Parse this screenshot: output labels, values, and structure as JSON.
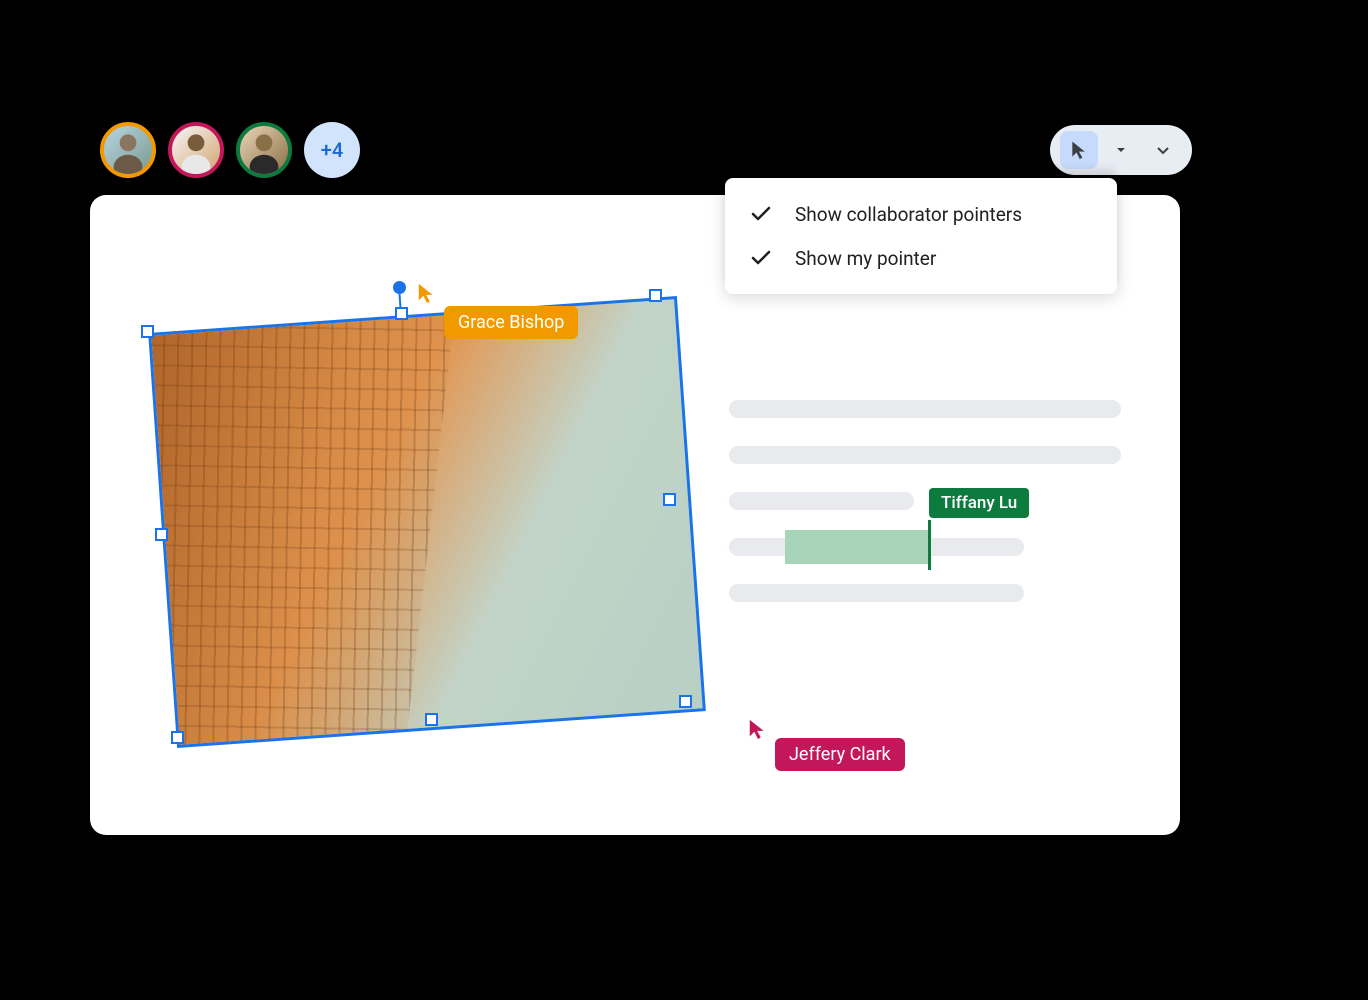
{
  "collaborators": {
    "avatar_overflow": "+4",
    "colors": {
      "avatar1_border": "#f29900",
      "avatar2_border": "#c2185b",
      "avatar3_border": "#0d7a3e"
    }
  },
  "menu": {
    "item1": "Show collaborator pointers",
    "item2": "Show my pointer"
  },
  "pointers": {
    "grace": {
      "name": "Grace Bishop",
      "color": "#f29900"
    },
    "jeffery": {
      "name": "Jeffery Clark",
      "color": "#c2185b"
    },
    "tiffany": {
      "name": "Tiffany Lu",
      "color": "#0d7a3e"
    }
  },
  "toolbar": {
    "selected_tool": "pointer"
  }
}
